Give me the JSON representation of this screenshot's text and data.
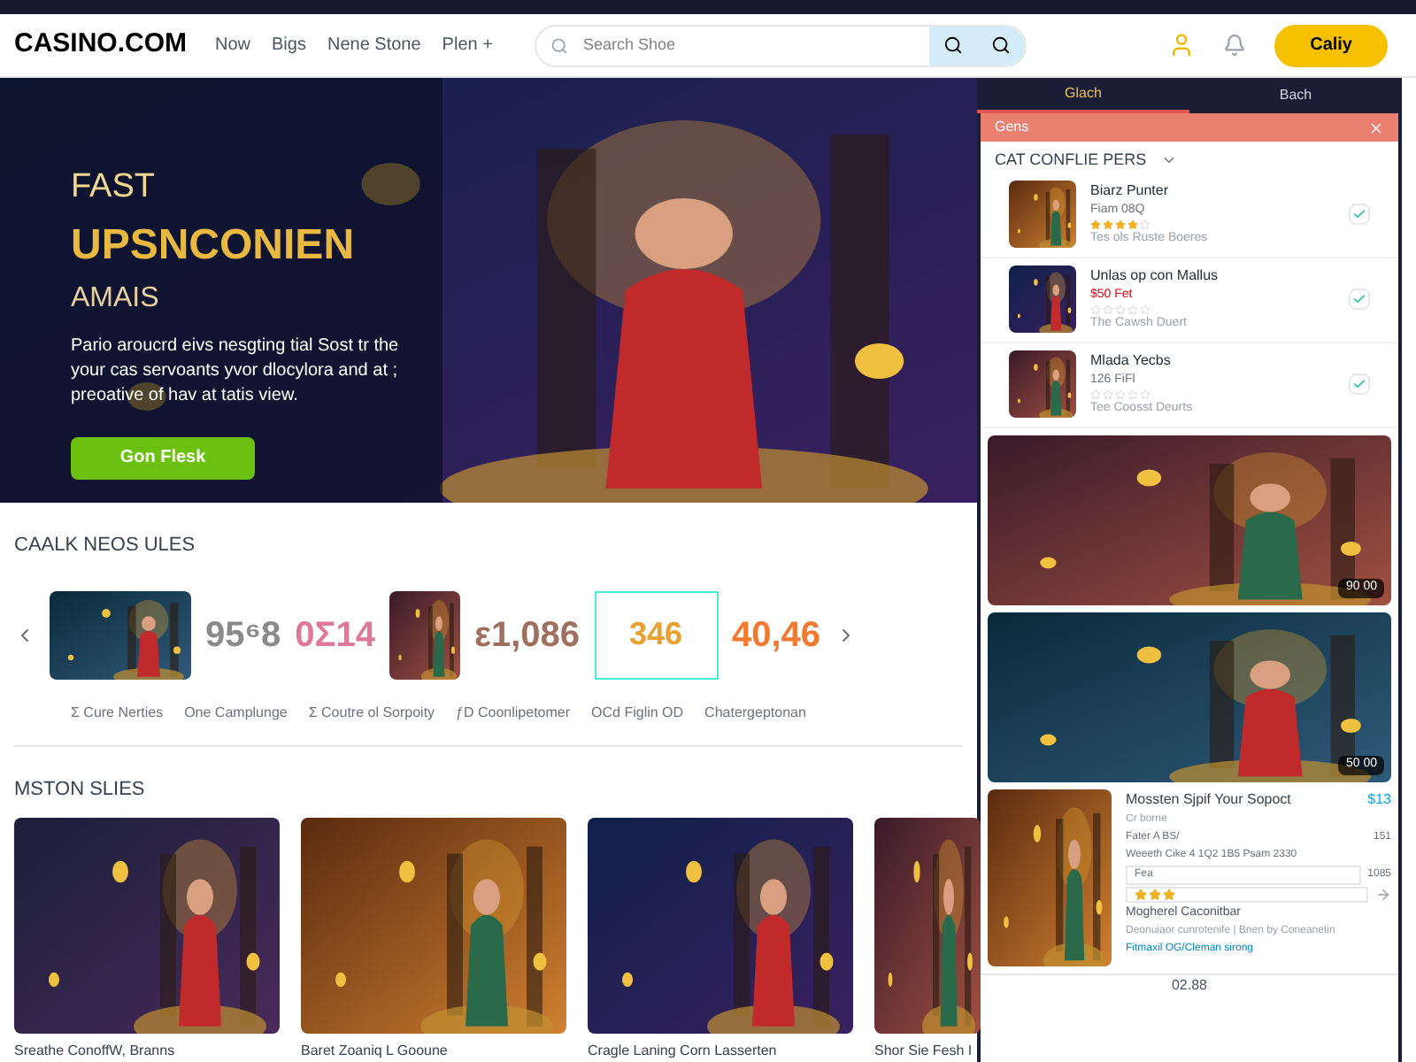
{
  "header": {
    "logo": "CASINO.COM",
    "nav": [
      "Now",
      "Bigs",
      "Nene Stone",
      "Plen +"
    ],
    "search": {
      "placeholder": "Search Shoe"
    },
    "cta": "Caliy"
  },
  "hero": {
    "kicker": "FAST",
    "title": "UPSNCONIEN",
    "subtitle": "AMAIS",
    "text": "Pario aroucrd eivs nesgting tial Sost tr the your cas servoants yvor dlocylora and at ; preoative of hav at tatis view.",
    "button": "Gon Flesk"
  },
  "promo": {
    "title": "CAALK NEOS ULES",
    "stats": [
      {
        "value": "95⁶8",
        "color": "#8a8a8a"
      },
      {
        "value": "0Σ14",
        "color": "#e0789a"
      },
      {
        "value": "ε1,086",
        "color": "#a0705f"
      },
      {
        "value": "346",
        "color": "#e8a030"
      },
      {
        "value": "40,46",
        "color": "#f07a30"
      }
    ],
    "captions": [
      "Σ Cure Nerties",
      "One Camplunge",
      "Σ Coutre ol Sorpoity",
      "ƒD Coonlipetomer",
      "OCd Figlin OD",
      "Chatergeptonan"
    ]
  },
  "slots": {
    "title": "MSTON SLIES",
    "games": [
      {
        "caption": "Sreathe ConoffW, Branns"
      },
      {
        "caption": "Baret Zoaniq L Gooune"
      },
      {
        "caption": "Cragle Laning Corn Lasserten"
      },
      {
        "caption": "Shor Sie Fesh I"
      }
    ]
  },
  "panel": {
    "tabs": [
      {
        "label": "Glach",
        "selected": true
      },
      {
        "label": "Bach",
        "selected": false
      }
    ],
    "alert": "Gens",
    "heading": "CAT CONFLIE PERS",
    "items": [
      {
        "title": "Biarz Punter",
        "sub": "Fiam 08Q",
        "meta": "Tes ols Ruste Boeres",
        "stars": 4
      },
      {
        "title": "Unlas op con Mallus",
        "sub": "$50 Fet",
        "meta": "The Cawsh Duert",
        "stars": 0
      },
      {
        "title": "Mlada Yecbs",
        "sub": "126 FiFl",
        "meta": "Tee Coosst Deurts",
        "stars": 0
      }
    ],
    "banners": [
      {
        "badge": "90 00"
      },
      {
        "badge": "50 00"
      }
    ],
    "detail": {
      "title": "Mossten Sjpif Your Sopoct",
      "price": "$13",
      "sub": "Cr borne",
      "line1": "Fater A BS/",
      "line1_value": "151",
      "line2": "Weeeth Cike 4 1Q2 1B5 Psam 2330",
      "field": "Fea",
      "field_value": "1085",
      "stars": 3,
      "heading": "Mogherel Caconitbar",
      "text": "Deonuiaor cunrotenife | Bnen by Coneanetin",
      "link": "Fitmaxil OG/Cleman sirong"
    },
    "footer": "02.88"
  }
}
